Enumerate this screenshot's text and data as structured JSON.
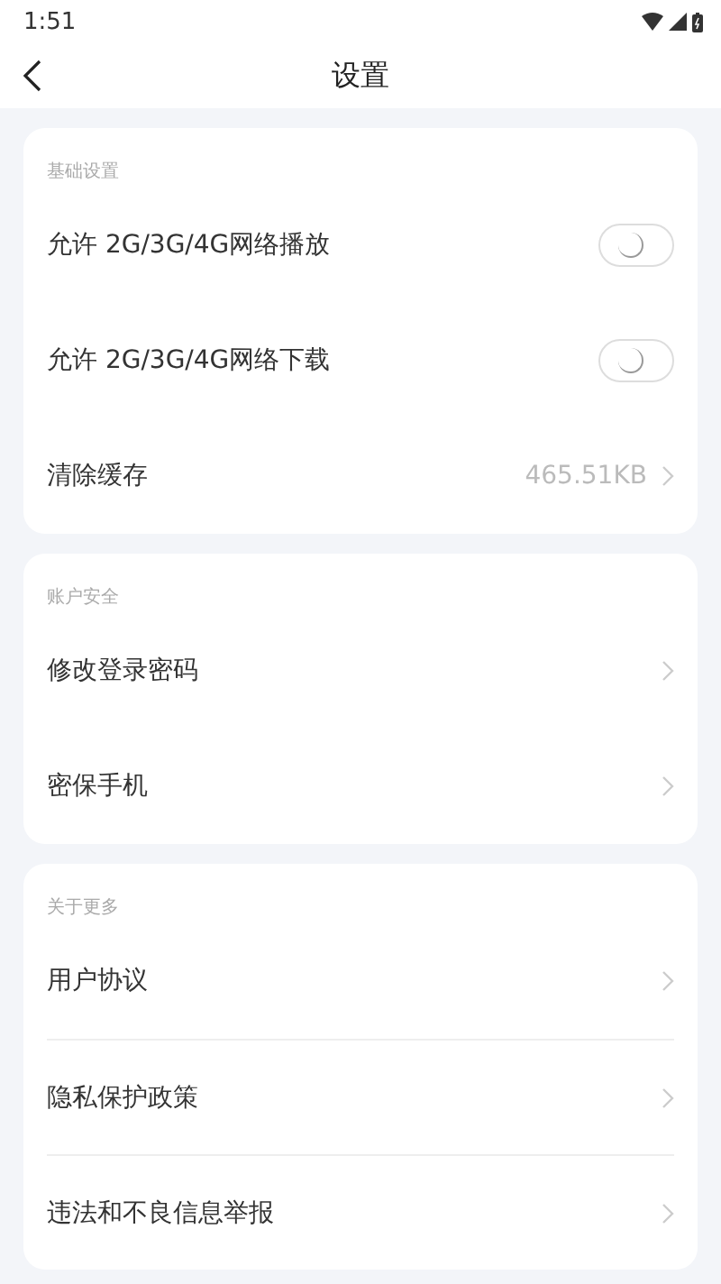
{
  "status_bar": {
    "time": "1:51"
  },
  "header": {
    "title": "设置"
  },
  "sections": [
    {
      "label": "基础设置",
      "dividers": false,
      "items": [
        {
          "kind": "toggle",
          "label": "允许 2G/3G/4G网络播放",
          "on": false
        },
        {
          "kind": "toggle",
          "label": "允许 2G/3G/4G网络下载",
          "on": false
        },
        {
          "kind": "value",
          "label": "清除缓存",
          "value": "465.51KB"
        }
      ]
    },
    {
      "label": "账户安全",
      "dividers": false,
      "items": [
        {
          "kind": "link",
          "label": "修改登录密码"
        },
        {
          "kind": "link",
          "label": "密保手机"
        }
      ]
    },
    {
      "label": "关于更多",
      "dividers": true,
      "items": [
        {
          "kind": "link",
          "label": "用户协议"
        },
        {
          "kind": "link",
          "label": "隐私保护政策"
        },
        {
          "kind": "link",
          "label": "违法和不良信息举报"
        }
      ]
    }
  ]
}
